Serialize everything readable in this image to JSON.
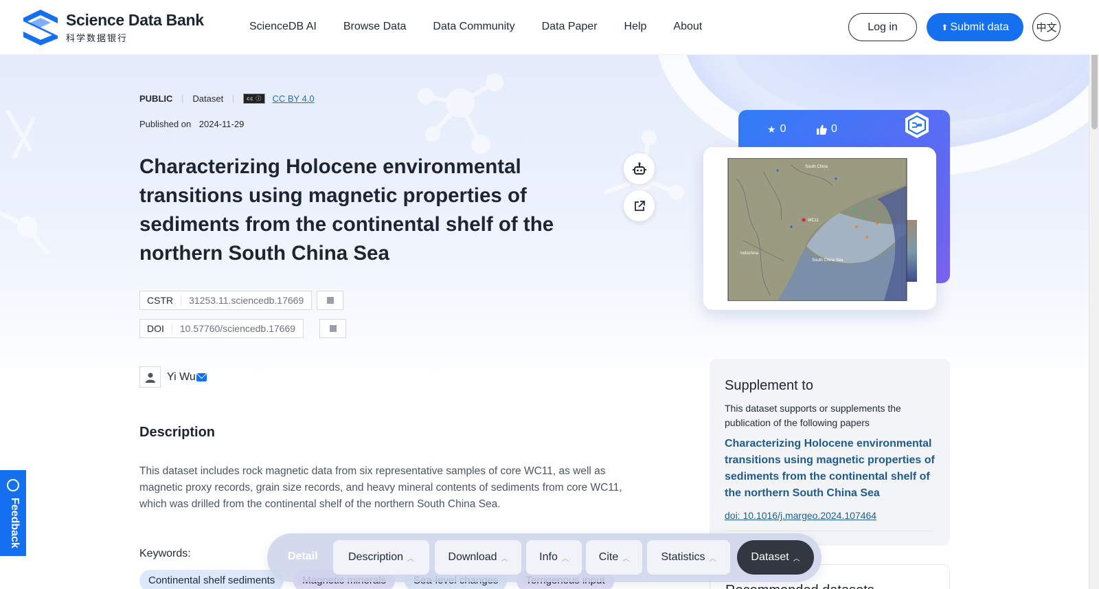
{
  "header": {
    "logo_en": "Science Data Bank",
    "logo_cn": "科学数据银行",
    "nav": [
      "ScienceDB AI",
      "Browse Data",
      "Data Community",
      "Data Paper",
      "Help",
      "About"
    ],
    "login_label": "Log in",
    "submit_label": "Submit data",
    "lang_label": "中文"
  },
  "dataset": {
    "access": "PUBLIC",
    "type": "Dataset",
    "license": "CC BY 4.0",
    "published_label": "Published on",
    "published_date": "2024-11-29",
    "title": "Characterizing Holocene environmental transitions using magnetic properties of sediments from the continental shelf of the northern South China Sea",
    "cstr_key": "CSTR",
    "cstr_value": "31253.11.sciencedb.17669",
    "doi_key": "DOI",
    "doi_value": "10.57760/sciencedb.17669",
    "author": "Yi Wu",
    "description_heading": "Description",
    "description": "This dataset includes rock magnetic data from six representative samples of core WC11, as well as magnetic proxy records, grain size records, and heavy mineral contents of sediments from core WC11, which was drilled from the continental shelf of the northern South China Sea.",
    "keywords_label": "Keywords:",
    "keywords": [
      "Continental shelf sediments",
      "Magnetic minerals",
      "Sea-level changes",
      "Terrigenous input"
    ]
  },
  "stats": {
    "stars": "0",
    "likes": "0"
  },
  "map": {
    "labels": [
      "South China",
      "Indochina",
      "South China Sea",
      "WC11"
    ]
  },
  "supplement": {
    "title": "Supplement to",
    "subtitle": "This dataset supports or supplements the publication of the following papers",
    "paper_title": "Characterizing Holocene environmental transitions using magnetic properties of sediments from the continental shelf of the northern South China Sea",
    "paper_doi": "doi: 10.1016/j.margeo.2024.107464"
  },
  "recommended": {
    "title": "Recommended datasets"
  },
  "feedback_label": "Feedback",
  "tabbar": {
    "detail_label": "Detail",
    "tabs": [
      "Description",
      "Download",
      "Info",
      "Cite",
      "Statistics",
      "Dataset"
    ]
  },
  "colors": {
    "brand": "#1570ef",
    "link": "#1d5b8f",
    "dark_tab": "#333742"
  }
}
